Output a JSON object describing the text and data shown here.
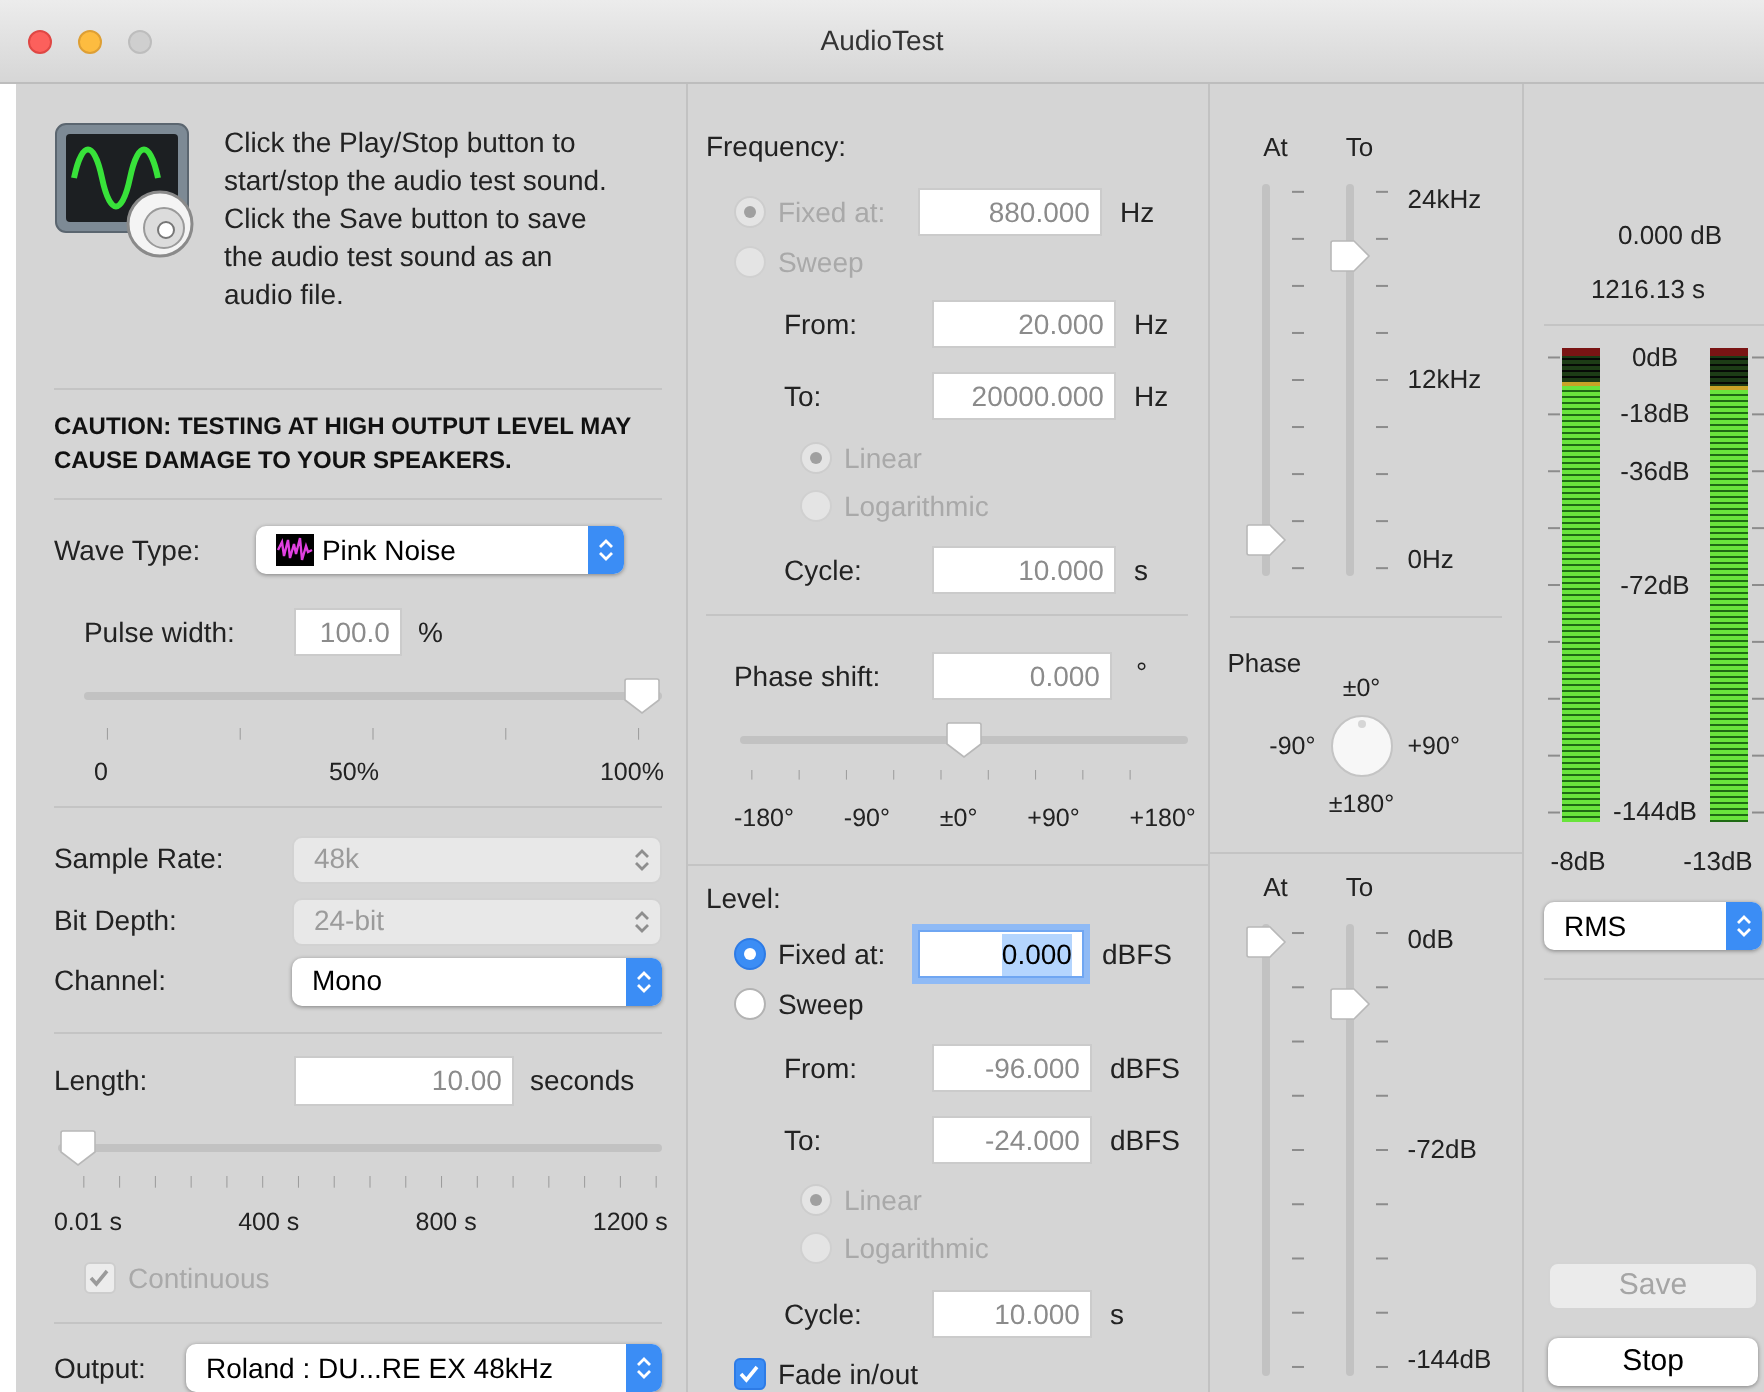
{
  "window": {
    "title": "AudioTest"
  },
  "info": {
    "text": "Click the Play/Stop button to start/stop the audio test sound. Click the Save button to save the audio test sound as an audio file."
  },
  "caution": "CAUTION: TESTING AT HIGH OUTPUT LEVEL MAY CAUSE DAMAGE TO YOUR SPEAKERS.",
  "wave_type": {
    "label": "Wave Type:",
    "value": "Pink Noise"
  },
  "pulse_width": {
    "label": "Pulse width:",
    "value": "100.0",
    "unit": "%",
    "level": 1,
    "tick_labels": [
      "0",
      "50%",
      "100%"
    ]
  },
  "format": [
    {
      "label": "Sample Rate:",
      "value": "48k",
      "disabled": true
    },
    {
      "label": "Bit Depth:",
      "value": "24-bit",
      "disabled": true
    },
    {
      "label": "Channel:",
      "value": "Mono",
      "disabled": false
    }
  ],
  "length": {
    "label": "Length:",
    "value": "10.00",
    "unit": "seconds",
    "level": 0,
    "tick_labels": [
      "0.01 s",
      "400 s",
      "800 s",
      "1200 s"
    ]
  },
  "continuous": {
    "label": "Continuous",
    "checked": true,
    "disabled": true
  },
  "output": {
    "label": "Output:",
    "value": "Roland : DU...RE EX 48kHz"
  },
  "frequency": {
    "title": "Frequency:",
    "modes": [
      {
        "label": "Fixed at:",
        "selected": true,
        "disabled": true
      },
      {
        "label": "Sweep",
        "selected": false,
        "disabled": true
      }
    ],
    "fixed": {
      "value": "880.000",
      "unit": "Hz"
    },
    "from": {
      "label": "From:",
      "value": "20.000",
      "unit": "Hz"
    },
    "to": {
      "label": "To:",
      "value": "20000.000",
      "unit": "Hz"
    },
    "scales": [
      {
        "label": "Linear",
        "selected": true,
        "disabled": true
      },
      {
        "label": "Logarithmic",
        "selected": false,
        "disabled": true
      }
    ],
    "cycle": {
      "label": "Cycle:",
      "value": "10.000",
      "unit": "s"
    }
  },
  "phase_shift": {
    "label": "Phase shift:",
    "value": "0.000",
    "unit": "°",
    "level": 0.5,
    "tick_labels": [
      "-180°",
      "-90°",
      "±0°",
      "+90°",
      "+180°"
    ]
  },
  "level": {
    "title": "Level:",
    "modes": [
      {
        "label": "Fixed at:",
        "selected": true,
        "disabled": false
      },
      {
        "label": "Sweep",
        "selected": false,
        "disabled": false
      }
    ],
    "fixed": {
      "value": "0.000",
      "unit": "dBFS",
      "focused": true
    },
    "from": {
      "label": "From:",
      "value": "-96.000",
      "unit": "dBFS"
    },
    "to": {
      "label": "To:",
      "value": "-24.000",
      "unit": "dBFS"
    },
    "scales": [
      {
        "label": "Linear",
        "selected": true,
        "disabled": true
      },
      {
        "label": "Logarithmic",
        "selected": false,
        "disabled": true
      }
    ],
    "cycle": {
      "label": "Cycle:",
      "value": "10.000",
      "unit": "s"
    },
    "fade": {
      "label": "Fade in/out",
      "checked": true,
      "disabled": false
    }
  },
  "frequency_sliders": {
    "headers": [
      "At",
      "To"
    ],
    "at": {
      "level": 0.05
    },
    "to": {
      "level": 0.85
    },
    "scale_labels": [
      "24kHz",
      "12kHz",
      "0Hz"
    ]
  },
  "phase_knob": {
    "title": "Phase",
    "top": "±0°",
    "left": "-90°",
    "right": "+90°",
    "bottom": "±180°"
  },
  "level_sliders": {
    "headers": [
      "At",
      "To"
    ],
    "at": {
      "level": 1
    },
    "to": {
      "level": 0.85
    },
    "scale_labels": [
      "0dB",
      "-72dB",
      "-144dB"
    ]
  },
  "meter": {
    "peak": "0.000 dB",
    "time": "1216.13 s",
    "scale_labels": [
      "0dB",
      "-18dB",
      "-36dB",
      "-72dB",
      "-144dB"
    ],
    "channels": [
      {
        "level": 0.93,
        "reading": "-8dB"
      },
      {
        "level": 0.92,
        "reading": "-13dB"
      }
    ],
    "mode": "RMS"
  },
  "buttons": [
    {
      "label": "Save",
      "disabled": true
    },
    {
      "label": "Stop",
      "disabled": false
    }
  ]
}
